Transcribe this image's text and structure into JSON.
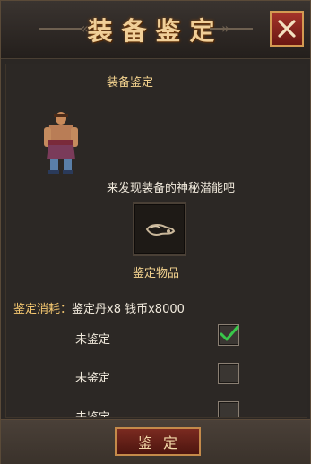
{
  "window": {
    "title": "装备鉴定",
    "close_icon": "close-icon"
  },
  "panel": {
    "heading": "装备鉴定",
    "hint": "来发现装备的神秘潜能吧",
    "item_label": "鉴定物品",
    "cost_label": "鉴定消耗：",
    "cost_value": "鉴定丹x8 钱币x8000"
  },
  "options": [
    {
      "label": "未鉴定",
      "checked": true
    },
    {
      "label": "未鉴定",
      "checked": false
    },
    {
      "label": "未鉴定",
      "checked": false
    }
  ],
  "footer": {
    "identify_label": "鉴定"
  },
  "colors": {
    "title": "#f0cf98",
    "accent_red": "#8e2a20",
    "check_green": "#39c84a",
    "cost_gold": "#f4c770"
  }
}
